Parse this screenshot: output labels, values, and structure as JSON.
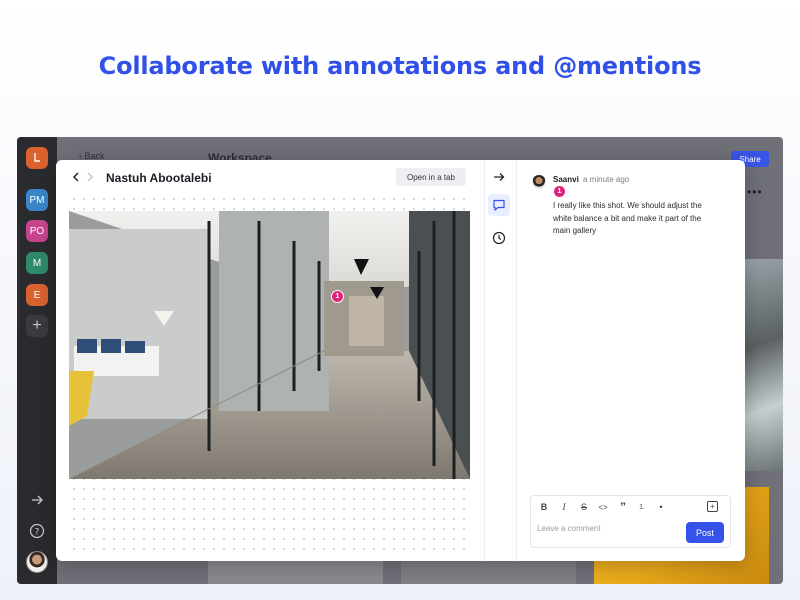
{
  "headline": "Collaborate with annotations and @mentions",
  "background_app": {
    "back_label": "Back",
    "workspace_title": "Workspace",
    "share_label": "Share",
    "workspaces": [
      {
        "label": "PM",
        "color": "#3a86c8"
      },
      {
        "label": "PO",
        "color": "#c8458e"
      },
      {
        "label": "M",
        "color": "#2f8a6a"
      },
      {
        "label": "E",
        "color": "#d9622f"
      }
    ],
    "add_symbol": "+",
    "more_symbol": "•••"
  },
  "viewer": {
    "title": "Nastuh Abootalebi",
    "open_in_tab_label": "Open in a tab",
    "pin_number": "1"
  },
  "comment": {
    "author": "Saanvi",
    "time": "a minute ago",
    "pin_number": "1",
    "text": "I really like this shot. We should adjust the white balance a bit and make it part of the main gallery"
  },
  "editor": {
    "placeholder": "Leave a comment",
    "post_label": "Post",
    "toolbar": [
      {
        "name": "bold-icon",
        "glyph": "B"
      },
      {
        "name": "italic-icon",
        "glyph": "I"
      },
      {
        "name": "strikethrough-icon",
        "glyph": "S"
      },
      {
        "name": "code-icon",
        "glyph": "<>"
      },
      {
        "name": "quote-icon",
        "glyph": "”"
      },
      {
        "name": "ordered-list-icon",
        "glyph": "1."
      },
      {
        "name": "bullet-list-icon",
        "glyph": "•"
      },
      {
        "name": "add-note-icon",
        "glyph": "+"
      }
    ]
  },
  "colors": {
    "accent": "#3553ea",
    "headline": "#3050e8",
    "pin": "#e0227a"
  }
}
